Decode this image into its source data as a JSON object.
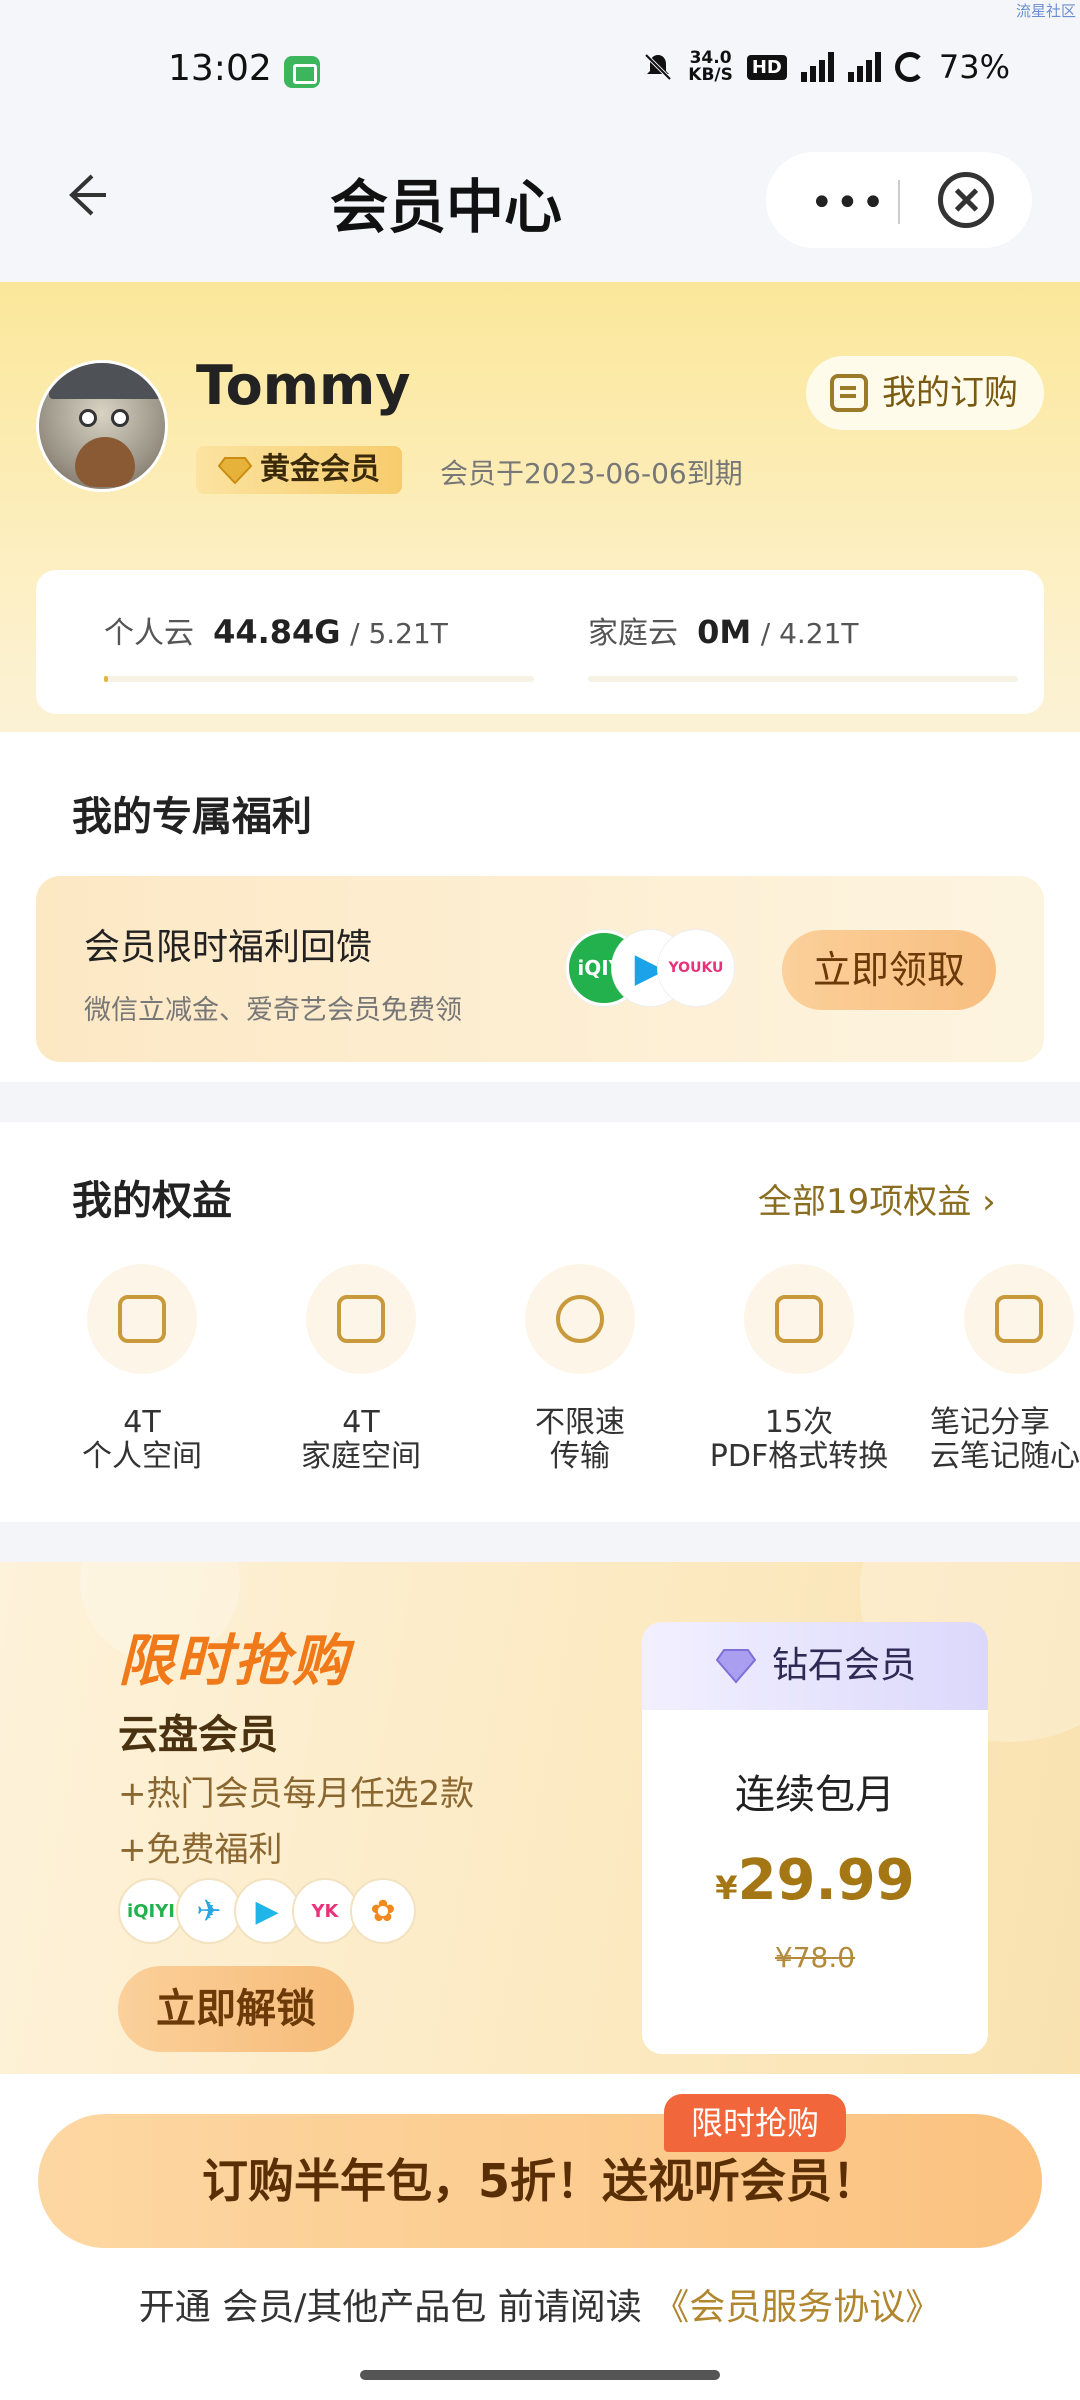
{
  "status_bar": {
    "time": "13:02",
    "net_speed_value": "34.0",
    "net_speed_unit": "KB/S",
    "hd": "HD",
    "battery": "73%",
    "watermark": "流星社区"
  },
  "nav": {
    "title": "会员中心",
    "more": "•••"
  },
  "profile": {
    "name": "Tommy",
    "badge": "黄金会员",
    "expire": "会员于2023-06-06到期",
    "my_order": "我的订购"
  },
  "storage": {
    "personal_label": "个人云",
    "personal_used": "44.84G",
    "personal_total": "/ 5.21T",
    "personal_progress": 0.01,
    "family_label": "家庭云",
    "family_used": "0M",
    "family_total": "/ 4.21T",
    "family_progress": 0
  },
  "welfare": {
    "section_title": "我的专属福利",
    "card_title": "会员限时福利回馈",
    "card_sub": "微信立减金、爱奇艺会员免费领",
    "logos": [
      "iQIYI",
      "▶",
      "YOUKU"
    ],
    "button": "立即领取"
  },
  "rights": {
    "section_title": "我的权益",
    "all_link": "全部19项权益 ›",
    "items": [
      {
        "l1": "4T",
        "l2": "个人空间",
        "icon": "hard-drive-icon"
      },
      {
        "l1": "4T",
        "l2": "家庭空间",
        "icon": "home-cloud-icon"
      },
      {
        "l1": "不限速",
        "l2": "传输",
        "icon": "lightning-icon"
      },
      {
        "l1": "15次",
        "l2": "PDF格式转换",
        "icon": "pdf-icon"
      },
      {
        "l1": "笔记分享",
        "l2": "云笔记随心",
        "icon": "note-share-icon"
      }
    ]
  },
  "promo": {
    "flash": "限时抢购",
    "name": "云盘会员",
    "line1": "+热门会员每月任选2款",
    "line2": "+免费福利",
    "app_logos": [
      "iQIYI",
      "✈",
      "▶",
      "YK",
      "✿"
    ],
    "unlock": "立即解锁",
    "card_title": "钻石会员",
    "card_cycle": "连续包月",
    "card_price_symbol": "¥",
    "card_price": "29.99",
    "card_old_price": "¥78.0"
  },
  "bottom": {
    "cta": "订购半年包，5折！送视听会员！",
    "cta_tag": "限时抢购",
    "agree_prefix": "开通 会员/其他产品包 前请阅读 ",
    "agree_link": "《会员服务协议》"
  },
  "colors": {
    "accent_gold": "#a47614",
    "cta_tag": "#f2663b",
    "hero_bg": "#fbe79a"
  }
}
